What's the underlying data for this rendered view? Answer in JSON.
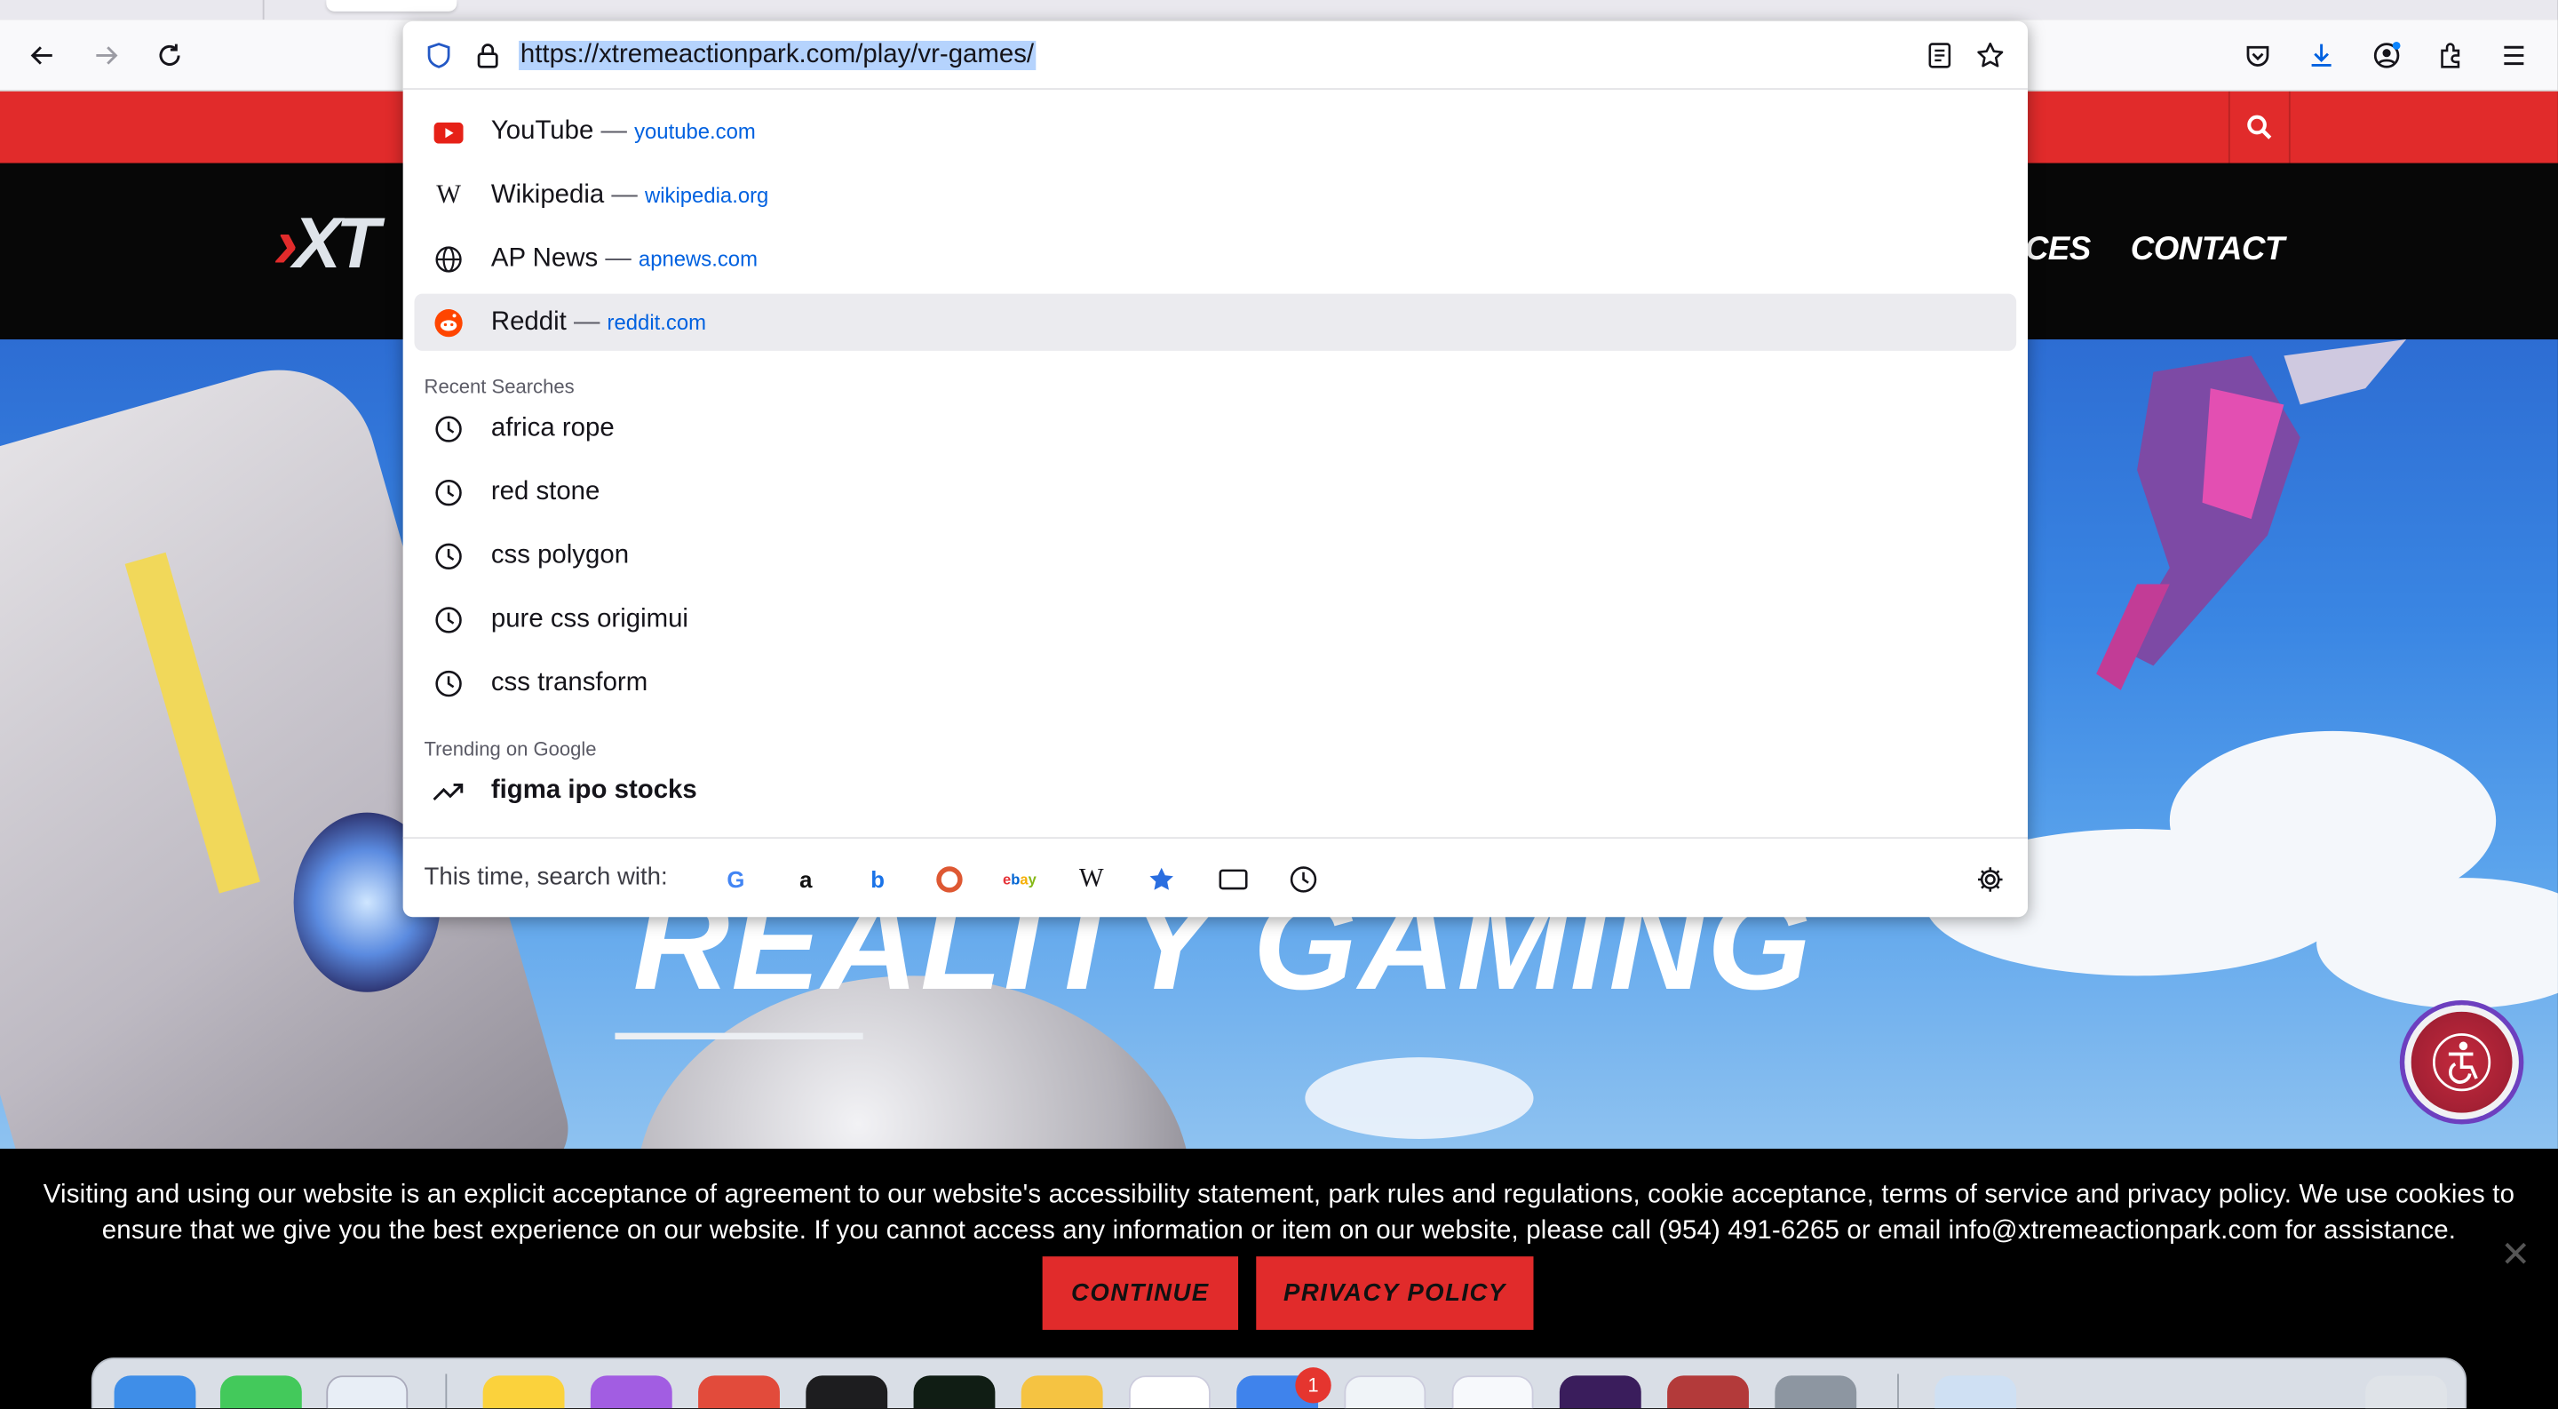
{
  "browser": {
    "url": "https://xtremeactionpark.com/play/vr-games/"
  },
  "site": {
    "logo_text": "XT",
    "nav": [
      "ICES",
      "CONTACT"
    ],
    "hero_title": "REALITY GAMING"
  },
  "dropdown": {
    "top_sites": [
      {
        "title": "YouTube",
        "url": "youtube.com",
        "icon": "youtube-icon"
      },
      {
        "title": "Wikipedia",
        "url": "wikipedia.org",
        "icon": "wikipedia-icon"
      },
      {
        "title": "AP News",
        "url": "apnews.com",
        "icon": "globe-icon"
      },
      {
        "title": "Reddit",
        "url": "reddit.com",
        "icon": "reddit-icon"
      }
    ],
    "separator": "—",
    "recent_heading": "Recent Searches",
    "recent": [
      "africa rope",
      "red stone",
      "css polygon",
      "pure css origimui",
      "css transform"
    ],
    "trending_heading": "Trending on Google",
    "trending": "figma ipo stocks",
    "search_with_label": "This time, search with:",
    "engines": [
      "google",
      "amazon",
      "bing",
      "duckduckgo",
      "ebay",
      "wikipedia",
      "bookmarks",
      "tabs",
      "history"
    ]
  },
  "cookie": {
    "text": "Visiting and using our website is an explicit acceptance of agreement to our website's accessibility statement, park rules and regulations, cookie acceptance, terms of service and privacy policy. We use cookies to ensure that we give you the best experience on our website. If you cannot access any information or item on our website, please call (954) 491-6265 or email info@xtremeactionpark.com for assistance.",
    "continue_label": "CONTINUE",
    "privacy_label": "PRIVACY POLICY",
    "close_glyph": "✕"
  },
  "dock": {
    "mail_badge": "1"
  },
  "colors": {
    "brand_red": "#e12b2b",
    "link_blue": "#0061e0",
    "selection": "#b5d3fd"
  }
}
